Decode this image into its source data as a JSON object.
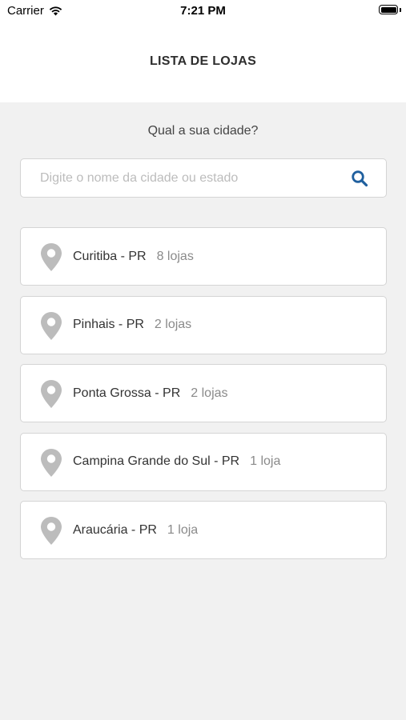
{
  "status_bar": {
    "carrier": "Carrier",
    "time": "7:21 PM"
  },
  "header": {
    "title": "LISTA DE LOJAS"
  },
  "search": {
    "question": "Qual a sua cidade?",
    "placeholder": "Digite o nome da cidade ou estado",
    "value": ""
  },
  "stores": [
    {
      "city": "Curitiba - PR",
      "count": "8 lojas"
    },
    {
      "city": "Pinhais - PR",
      "count": "2 lojas"
    },
    {
      "city": "Ponta Grossa - PR",
      "count": "2 lojas"
    },
    {
      "city": "Campina Grande do Sul - PR",
      "count": "1 loja"
    },
    {
      "city": "Araucária - PR",
      "count": "1 loja"
    }
  ],
  "colors": {
    "accent": "#1f5f9e",
    "pin": "#bcbcbc",
    "background": "#f1f1f1"
  }
}
